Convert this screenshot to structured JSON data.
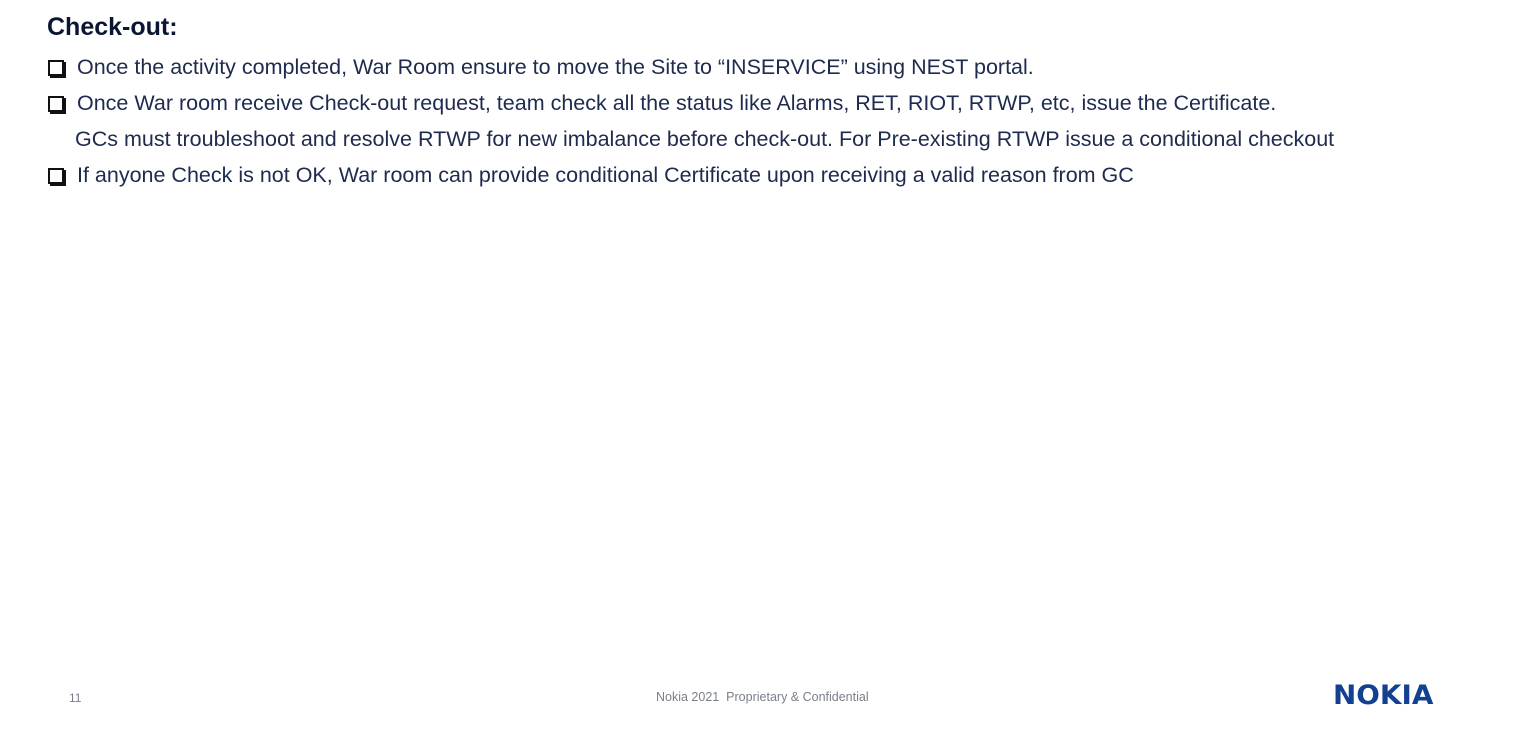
{
  "slide": {
    "title": "Check-out:",
    "bullets": [
      {
        "type": "bullet",
        "text": "Once the activity completed, War Room ensure to move the Site to “INSERVICE” using NEST portal."
      },
      {
        "type": "bullet",
        "text": "Once War room receive Check-out request, team check all the status like Alarms, RET, RIOT, RTWP, etc, issue the Certificate."
      },
      {
        "type": "sub",
        "text": "GCs must troubleshoot and resolve RTWP for new imbalance before check-out. For Pre-existing RTWP issue a conditional checkout"
      },
      {
        "type": "bullet",
        "text": "If anyone Check is not OK, War room can provide conditional Certificate upon receiving a valid reason from GC"
      }
    ],
    "bullet_icon": "checkbox-square-icon"
  },
  "footer": {
    "page_number": "11",
    "confidentiality": "Nokia 2021  Proprietary & Confidential",
    "logo_text": "NOKIA"
  },
  "colors": {
    "title": "#0b1633",
    "body_text": "#1e2a4e",
    "footer_text": "#7a7f8c",
    "brand": "#124191"
  }
}
